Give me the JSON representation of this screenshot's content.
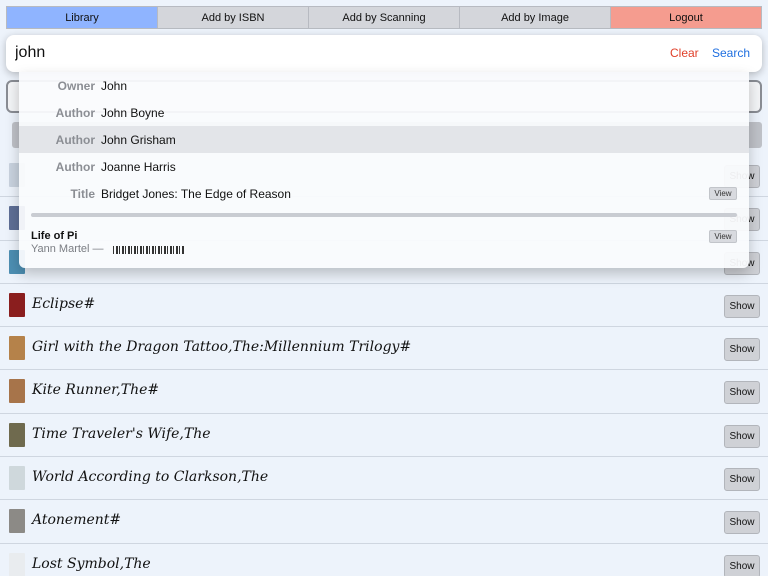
{
  "nav": {
    "tabs": [
      {
        "label": "Library"
      },
      {
        "label": "Add by ISBN"
      },
      {
        "label": "Add by Scanning"
      },
      {
        "label": "Add by Image"
      },
      {
        "label": "Logout"
      }
    ]
  },
  "search": {
    "value": "john",
    "clear_label": "Clear",
    "submit_label": "Search"
  },
  "suggestions": [
    {
      "type": "Owner",
      "value": "John"
    },
    {
      "type": "Author",
      "value": "John Boyne"
    },
    {
      "type": "Author",
      "value": "John Grisham"
    },
    {
      "type": "Author",
      "value": "Joanne Harris"
    },
    {
      "type": "Title",
      "value": "Bridget Jones: The Edge of Reason",
      "view_label": "View"
    }
  ],
  "result": {
    "title": "Life of Pi",
    "author": "Yann Martel —",
    "view_label": "View"
  },
  "books": [
    {
      "title": "",
      "cover_color": "#c9d3df",
      "show_label": "Show"
    },
    {
      "title": "",
      "cover_color": "#5e6f96",
      "show_label": "Show"
    },
    {
      "title": "",
      "cover_color": "#4d8fb3",
      "show_label": "Show"
    },
    {
      "title": "Eclipse#",
      "cover_color": "#8a1e1e",
      "show_label": "Show"
    },
    {
      "title": "Girl with the Dragon Tattoo,The:Millennium Trilogy#",
      "cover_color": "#b5824a",
      "show_label": "Show"
    },
    {
      "title": "Kite Runner,The#",
      "cover_color": "#a7744a",
      "show_label": "Show"
    },
    {
      "title": "Time Traveler's Wife,The",
      "cover_color": "#6f6a4e",
      "show_label": "Show"
    },
    {
      "title": "World According to Clarkson,The",
      "cover_color": "#cfd8dc",
      "show_label": "Show"
    },
    {
      "title": "Atonement#",
      "cover_color": "#8c8a86",
      "show_label": "Show"
    },
    {
      "title": "Lost Symbol,The",
      "cover_color": "#e9ecef",
      "show_label": "Show"
    }
  ]
}
